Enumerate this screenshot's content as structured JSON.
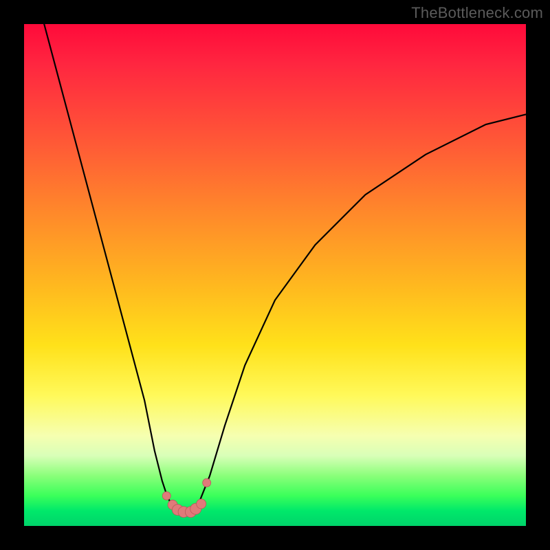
{
  "watermark": "TheBottleneck.com",
  "colors": {
    "bg": "#000000",
    "gradient_top": "#ff0a3a",
    "gradient_bottom": "#00d46a",
    "curve": "#000000",
    "marker_fill": "#e07a7a",
    "marker_stroke": "#b85a5a"
  },
  "chart_data": {
    "type": "line",
    "title": "",
    "xlabel": "",
    "ylabel": "",
    "xlim": [
      0,
      100
    ],
    "ylim": [
      0,
      100
    ],
    "series": [
      {
        "name": "left-arm",
        "x": [
          4,
          8,
          12,
          16,
          20,
          24,
          26,
          27.5,
          28.5,
          29.5,
          30.5
        ],
        "y": [
          100,
          85,
          70,
          55,
          40,
          25,
          15,
          9,
          6,
          4,
          3
        ]
      },
      {
        "name": "right-arm",
        "x": [
          34,
          35,
          37,
          40,
          44,
          50,
          58,
          68,
          80,
          92,
          100
        ],
        "y": [
          3,
          5,
          10,
          20,
          32,
          45,
          56,
          66,
          74,
          80,
          82
        ]
      },
      {
        "name": "valley-floor",
        "x": [
          30.5,
          31.5,
          32.5,
          33.5,
          34
        ],
        "y": [
          3,
          2.5,
          2.5,
          2.7,
          3
        ]
      }
    ],
    "markers": {
      "name": "valley-markers",
      "x": [
        28.4,
        29.6,
        30.6,
        31.8,
        33.2,
        34.2,
        35.3,
        36.4
      ],
      "y": [
        6.0,
        4.2,
        3.2,
        2.8,
        2.8,
        3.4,
        4.4,
        8.6
      ],
      "r": [
        6,
        7,
        8,
        8,
        8,
        8,
        7,
        6
      ]
    },
    "background_gradient_axis": "y",
    "background_meaning": "low-y green (good) to high-y red (bad)"
  }
}
